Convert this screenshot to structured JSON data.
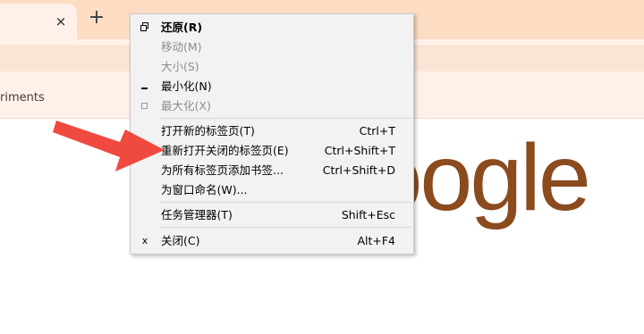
{
  "browser": {
    "tab_close_glyph": "×",
    "new_tab_glyph": "+",
    "bookmark_text": "riments"
  },
  "page": {
    "logo_text": "Google",
    "logo_color": "#8b4b1f"
  },
  "menu": {
    "items": [
      {
        "label": "还原(R)",
        "shortcut": "",
        "icon": "restore-icon",
        "state": "enabled-bold"
      },
      {
        "label": "移动(M)",
        "shortcut": "",
        "icon": "",
        "state": "disabled"
      },
      {
        "label": "大小(S)",
        "shortcut": "",
        "icon": "",
        "state": "disabled"
      },
      {
        "label": "最小化(N)",
        "shortcut": "",
        "icon": "minimize-icon",
        "state": "enabled"
      },
      {
        "label": "最大化(X)",
        "shortcut": "",
        "icon": "maximize-icon",
        "state": "disabled"
      },
      {
        "label": "打开新的标签页(T)",
        "shortcut": "Ctrl+T",
        "icon": "",
        "state": "enabled"
      },
      {
        "label": "重新打开关闭的标签页(E)",
        "shortcut": "Ctrl+Shift+T",
        "icon": "",
        "state": "enabled"
      },
      {
        "label": "为所有标签页添加书签...",
        "shortcut": "Ctrl+Shift+D",
        "icon": "",
        "state": "enabled"
      },
      {
        "label": "为窗口命名(W)...",
        "shortcut": "",
        "icon": "",
        "state": "enabled"
      },
      {
        "label": "任务管理器(T)",
        "shortcut": "Shift+Esc",
        "icon": "",
        "state": "enabled"
      },
      {
        "label": "关闭(C)",
        "shortcut": "Alt+F4",
        "icon": "close-icon",
        "state": "enabled"
      }
    ],
    "close_glyph": "x"
  },
  "annotation": {
    "arrow_color": "#f0493f"
  }
}
